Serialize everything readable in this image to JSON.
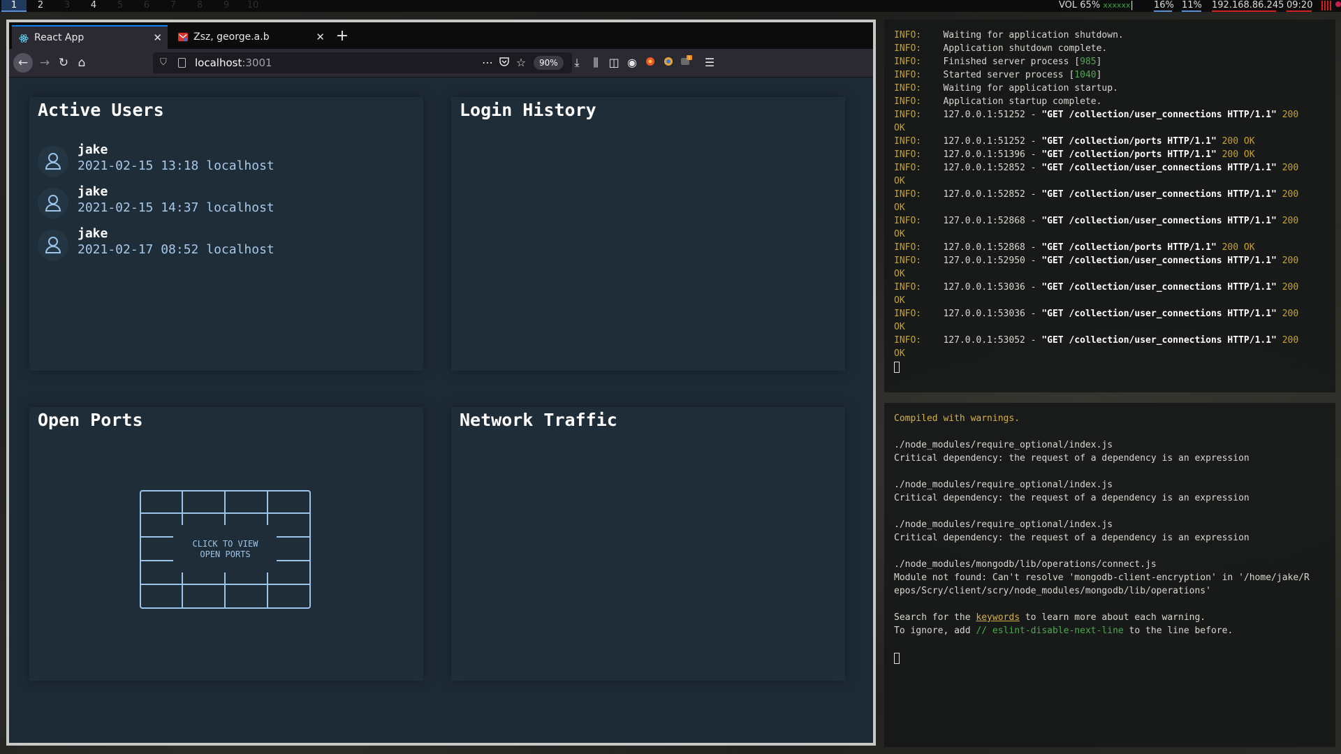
{
  "topbar": {
    "workspaces": [
      {
        "label": "1",
        "state": "active"
      },
      {
        "label": "2",
        "state": "used"
      },
      {
        "label": "3",
        "state": "empty"
      },
      {
        "label": "4",
        "state": "used"
      },
      {
        "label": "5",
        "state": "empty"
      },
      {
        "label": "6",
        "state": "empty"
      },
      {
        "label": "7",
        "state": "empty"
      },
      {
        "label": "8",
        "state": "empty"
      },
      {
        "label": "9",
        "state": "empty"
      },
      {
        "label": "10",
        "state": "empty"
      }
    ],
    "volume": "VOL 65%",
    "volume_dots": "xxxxxx",
    "cpu": "16%",
    "mem": "11%",
    "ip": "192.168.86.245",
    "clock": "09:20"
  },
  "browser": {
    "tabs": [
      {
        "title": "React App",
        "icon": "react-icon",
        "active": true
      },
      {
        "title": "Zsz, george.a.b",
        "icon": "mail-icon",
        "active": false
      }
    ],
    "new_tab": "+",
    "url_host": "localhost",
    "url_port": ":3001",
    "zoom": "90%",
    "toolbar_badge": "1"
  },
  "dashboard": {
    "active_users": {
      "title": "Active Users",
      "users": [
        {
          "name": "jake",
          "meta": "2021-02-15 13:18 localhost"
        },
        {
          "name": "jake",
          "meta": "2021-02-15 14:37 localhost"
        },
        {
          "name": "jake",
          "meta": "2021-02-17 08:52 localhost"
        }
      ]
    },
    "login_history": {
      "title": "Login History"
    },
    "open_ports": {
      "title": "Open Ports",
      "button_line1": "CLICK TO VIEW",
      "button_line2": "OPEN PORTS"
    },
    "network_traffic": {
      "title": "Network Traffic"
    }
  },
  "terminal_server": {
    "lines": [
      {
        "lvl": "INFO:",
        "msg": "    Waiting for application shutdown."
      },
      {
        "lvl": "INFO:",
        "msg": "    Application shutdown complete."
      },
      {
        "lvl": "INFO:",
        "pre": "    Finished server process [",
        "num": "985",
        "post": "]"
      },
      {
        "lvl": "INFO:",
        "pre": "    Started server process [",
        "num": "1040",
        "post": "]"
      },
      {
        "lvl": "INFO:",
        "msg": "    Waiting for application startup."
      },
      {
        "lvl": "INFO:",
        "msg": "    Application startup complete."
      },
      {
        "lvl": "INFO:",
        "addr": "    127.0.0.1:51252 - ",
        "req": "\"GET /collection/user_connections HTTP/1.1\"",
        "status": " 200",
        "wrap": "OK"
      },
      {
        "lvl": "INFO:",
        "addr": "    127.0.0.1:51252 - ",
        "req": "\"GET /collection/ports HTTP/1.1\"",
        "status": " 200 OK"
      },
      {
        "lvl": "INFO:",
        "addr": "    127.0.0.1:51396 - ",
        "req": "\"GET /collection/ports HTTP/1.1\"",
        "status": " 200 OK"
      },
      {
        "lvl": "INFO:",
        "addr": "    127.0.0.1:52852 - ",
        "req": "\"GET /collection/user_connections HTTP/1.1\"",
        "status": " 200",
        "wrap": "OK"
      },
      {
        "lvl": "INFO:",
        "addr": "    127.0.0.1:52852 - ",
        "req": "\"GET /collection/user_connections HTTP/1.1\"",
        "status": " 200",
        "wrap": "OK"
      },
      {
        "lvl": "INFO:",
        "addr": "    127.0.0.1:52868 - ",
        "req": "\"GET /collection/user_connections HTTP/1.1\"",
        "status": " 200",
        "wrap": "OK"
      },
      {
        "lvl": "INFO:",
        "addr": "    127.0.0.1:52868 - ",
        "req": "\"GET /collection/ports HTTP/1.1\"",
        "status": " 200 OK"
      },
      {
        "lvl": "INFO:",
        "addr": "    127.0.0.1:52950 - ",
        "req": "\"GET /collection/user_connections HTTP/1.1\"",
        "status": " 200",
        "wrap": "OK"
      },
      {
        "lvl": "INFO:",
        "addr": "    127.0.0.1:53036 - ",
        "req": "\"GET /collection/user_connections HTTP/1.1\"",
        "status": " 200",
        "wrap": "OK"
      },
      {
        "lvl": "INFO:",
        "addr": "    127.0.0.1:53036 - ",
        "req": "\"GET /collection/user_connections HTTP/1.1\"",
        "status": " 200",
        "wrap": "OK"
      },
      {
        "lvl": "INFO:",
        "addr": "    127.0.0.1:53052 - ",
        "req": "\"GET /collection/user_connections HTTP/1.1\"",
        "status": " 200",
        "wrap": "OK"
      }
    ]
  },
  "terminal_build": {
    "compiled": "Compiled with warnings.",
    "warnings": [
      {
        "file": "./node_modules/require_optional/index.js",
        "msg": "Critical dependency: the request of a dependency is an expression"
      },
      {
        "file": "./node_modules/require_optional/index.js",
        "msg": "Critical dependency: the request of a dependency is an expression"
      },
      {
        "file": "./node_modules/require_optional/index.js",
        "msg": "Critical dependency: the request of a dependency is an expression"
      }
    ],
    "connect_file": "./node_modules/mongodb/lib/operations/connect.js",
    "module_error_1": "Module not found: Can't resolve 'mongodb-client-encryption' in '/home/jake/R",
    "module_error_2": "epos/Scry/client/scry/node_modules/mongodb/lib/operations'",
    "search_pre": "Search for the ",
    "search_link": "keywords",
    "search_post": " to learn more about each warning.",
    "ignore_pre": "To ignore, add ",
    "ignore_code": "// eslint-disable-next-line",
    "ignore_post": " to the line before."
  }
}
